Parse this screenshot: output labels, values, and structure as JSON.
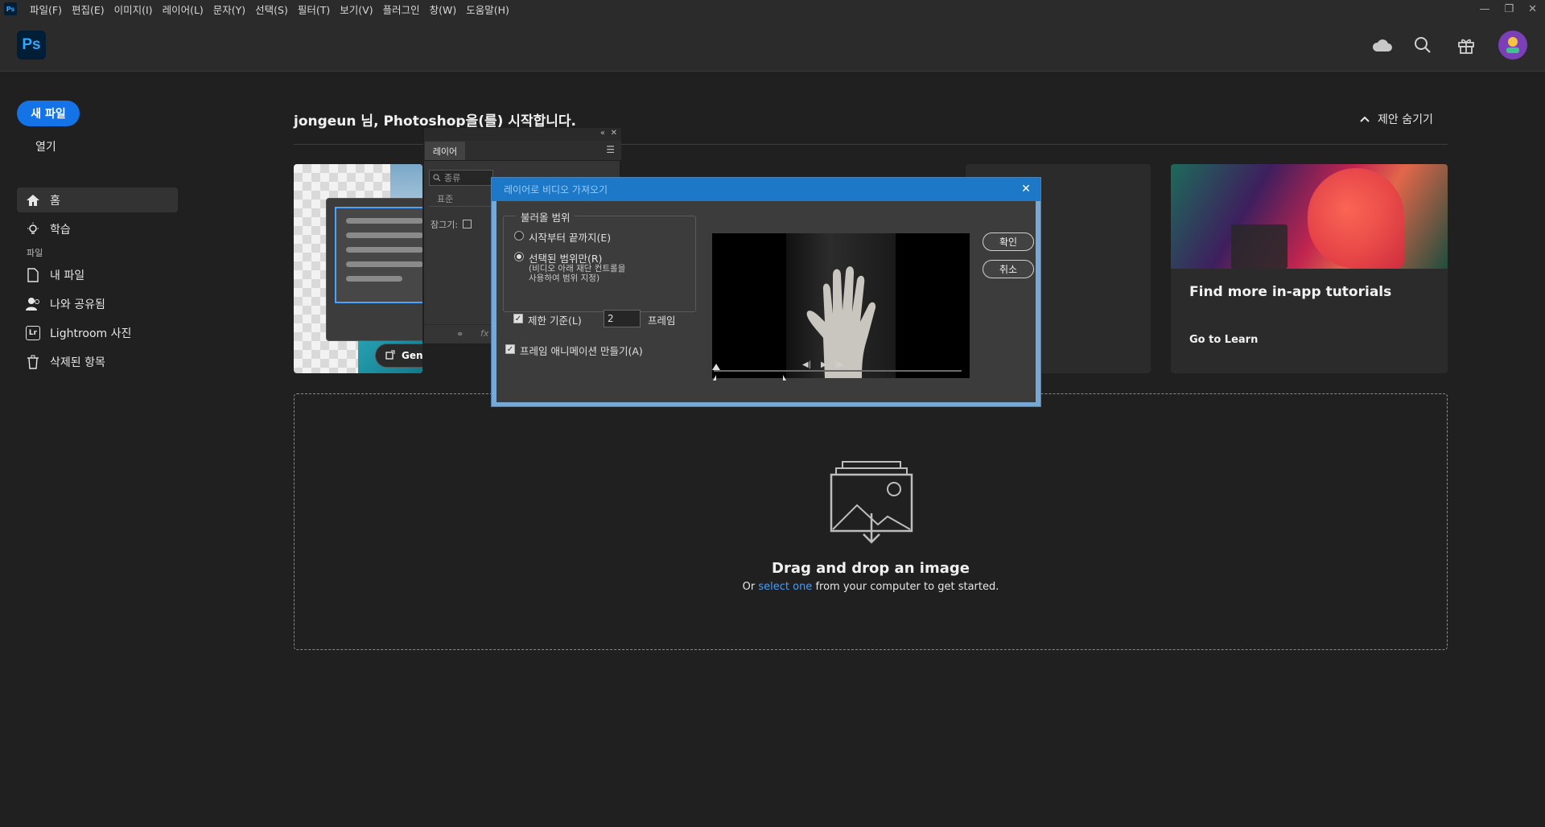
{
  "menubar": {
    "ps_mini": "Ps",
    "items": [
      "파일(F)",
      "편집(E)",
      "이미지(I)",
      "레이어(L)",
      "문자(Y)",
      "선택(S)",
      "필터(T)",
      "보기(V)",
      "플러그인",
      "창(W)",
      "도움말(H)"
    ]
  },
  "appbar": {
    "logo": "Ps"
  },
  "sidebar": {
    "new_file": "새 파일",
    "open": "열기",
    "home": "홈",
    "learn": "학습",
    "section": "파일",
    "my_files": "내 파일",
    "shared": "나와 공유됨",
    "lightroom": "Lightroom 사진",
    "lightroom_badge": "Lr",
    "deleted": "삭제된 항목"
  },
  "main": {
    "welcome": "jongeun 님, Photoshop을(를) 시작합니다.",
    "hide_suggestions": "제안 숨기기",
    "card1_button": "Gene",
    "card3_title": "Find more in-app tutorials",
    "card3_link": "Go to Learn",
    "drop_title": "Drag and drop an image",
    "drop_sub_before": "Or",
    "drop_sub_link": "select one",
    "drop_sub_after": "from your computer to get started."
  },
  "layers_panel": {
    "tab": "레이어",
    "search_placeholder": "종류",
    "blend_mode": "표준",
    "lock_label": "잠그기:"
  },
  "dialog": {
    "title": "레이어로 비디오 가져오기",
    "range_group": "불러올 범위",
    "option_all": "시작부터 끝까지(E)",
    "option_selected": "선택된 범위만(R)",
    "option_selected_hint_1": "(비디오 아래 재단 컨트롤을",
    "option_selected_hint_2": "사용하여 범위 지정)",
    "limit_label": "제한 기준(L)",
    "limit_value": "2",
    "limit_unit": "프레임",
    "make_animation": "프레임 애니메이션 만들기(A)",
    "ok": "확인",
    "cancel": "취소",
    "selected_option": "option_selected",
    "limit_checked": true,
    "make_animation_checked": true
  },
  "colors": {
    "accent": "#1473e6",
    "ps_blue": "#31a8ff",
    "dialog_title": "#1e78c8",
    "link": "#4b9cf5"
  }
}
